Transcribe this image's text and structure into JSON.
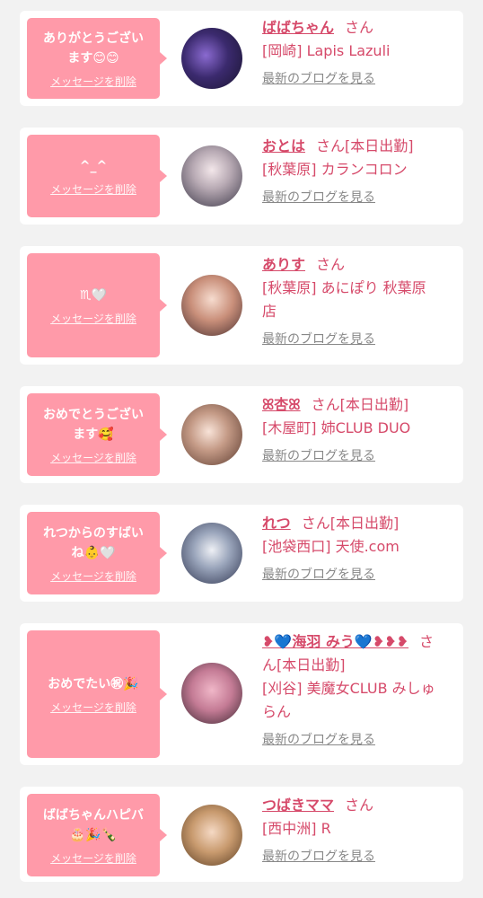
{
  "cards": [
    {
      "message_line1": "ありがとうござい",
      "message_line2": "ます😊😊",
      "delete": "メッセージを削除",
      "name": "ばばちゃん",
      "san": "さん",
      "status": "",
      "shop": "[岡崎] Lapis Lazuli",
      "shop2": "",
      "blog": "最新のブログを見る"
    },
    {
      "message_line1": "^_^",
      "message_line2": "",
      "delete": "メッセージを削除",
      "name": "おとは",
      "san": "さん",
      "status": "[本日出勤]",
      "shop": "[秋葉原] カランコロン",
      "shop2": "",
      "blog": "最新のブログを見る"
    },
    {
      "message_line1": "♏🤍",
      "message_line2": "",
      "delete": "メッセージを削除",
      "name": "ありす",
      "san": "さん",
      "status": "",
      "shop": "[秋葉原] あにぽり 秋葉原",
      "shop2": "店",
      "blog": "最新のブログを見る"
    },
    {
      "message_line1": "おめでとうござい",
      "message_line2": "ます🥰",
      "delete": "メッセージを削除",
      "name": "ꕤ杏ꕤ",
      "san": "さん",
      "status": "[本日出勤]",
      "shop": "[木屋町] 姉CLUB DUO",
      "shop2": "",
      "blog": "最新のブログを見る"
    },
    {
      "message_line1": "れつからのすばい",
      "message_line2": "ね👶🤍",
      "delete": "メッセージを削除",
      "name": "れつ",
      "san": "さん",
      "status": "[本日出勤]",
      "shop": "[池袋西口] 天使.com",
      "shop2": "",
      "blog": "最新のブログを見る"
    },
    {
      "message_line1": "おめでたい㊗🎉",
      "message_line2": "",
      "delete": "メッセージを削除",
      "name": "❥💙海羽 みう💙❥❥❥",
      "san": "さ",
      "san2": "ん",
      "status": "[本日出勤]",
      "shop": "[刈谷] 美魔女CLUB みしゅ",
      "shop2": "らん",
      "blog": "最新のブログを見る"
    },
    {
      "message_line1": "ばばちゃんハピバ",
      "message_line2": "🎂🎉🍾",
      "delete": "メッセージを削除",
      "name": "つばきママ",
      "san": "さん",
      "status": "",
      "shop": "[西中洲] R",
      "shop2": "",
      "blog": "最新のブログを見る"
    }
  ]
}
